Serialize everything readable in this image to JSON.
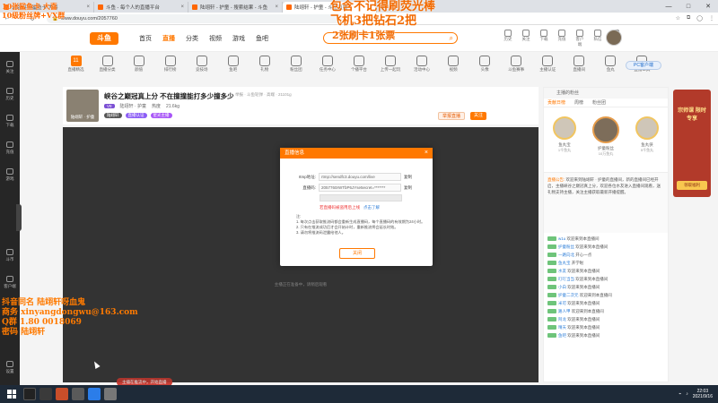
{
  "browser": {
    "tabs": [
      {
        "label": "10张斗鱼鲨鱼卡  大喜",
        "active": false
      },
      {
        "label": "斗鱼 - 每个人的直播平台",
        "active": false
      },
      {
        "label": "陆翊轩 - 护童 - 搜索结果 - 斗鱼",
        "active": false
      },
      {
        "label": "陆翊轩 - 护童 - 斗鱼直播",
        "active": true
      }
    ],
    "url": "www.douyu.com/2057760"
  },
  "site": {
    "logo_text": "斗鱼",
    "nav": [
      "首页",
      "直播",
      "分类",
      "视频",
      "游戏",
      "鱼吧"
    ],
    "header_icons": [
      "历史",
      "关注",
      "下载",
      "充值",
      "客户端",
      "私信",
      "通知"
    ]
  },
  "categories": [
    {
      "label": "直播精选",
      "top": "11",
      "sub": "开播数"
    },
    {
      "label": "直播分类"
    },
    {
      "label": "颜值"
    },
    {
      "label": "排行榜"
    },
    {
      "label": "竞技场"
    },
    {
      "label": "鱼吧"
    },
    {
      "label": "礼物"
    },
    {
      "label": "粉丝团"
    },
    {
      "label": "任务中心"
    },
    {
      "label": "个播平台"
    },
    {
      "label": "上传一起玩"
    },
    {
      "label": "活动中心"
    },
    {
      "label": "视频"
    },
    {
      "label": "头像"
    },
    {
      "label": "斗鱼赛事"
    },
    {
      "label": "主播认证"
    },
    {
      "label": "直播间"
    },
    {
      "label": "鱼丸"
    },
    {
      "label": "直播工具"
    }
  ],
  "pc_client_button": "PC客户端",
  "sidebar": [
    "关注",
    "历史",
    "下载",
    "充值",
    "游戏",
    "斗币",
    "客户端",
    "设置"
  ],
  "room": {
    "title": "峡谷之巅冠真上分 不在撞撞能打多少撞多少",
    "subtitle": "举报  · 斗鱼轮弹 · 高端 · 21101g",
    "streamer": "陆翊轩 · 护童",
    "thumb_label": "陆翊轩 · 护童",
    "level_tag": "V8",
    "hot": "热度",
    "fans": "21.6kg",
    "badges": [
      "陆翊轩",
      "直播认证",
      "星光主播"
    ],
    "report_label": "举报直播",
    "follow_label": "关注"
  },
  "player": {
    "message": "主播正在准备中，请稍后观看",
    "bottom_banner": "主播在推流中，开始直播"
  },
  "modal": {
    "title": "直播信息",
    "rtmp_label": "rtmp地址:",
    "rtmp_value": "rtmp://sendfc3.douyu.com/live",
    "rtmp_copy": "复制",
    "code_label": "直播码:",
    "code_value": "2057760rWTbP6JYse5ecret=*******",
    "code_copy": "复制",
    "warn": "若直播码被盗用后上线",
    "warn_link": "点击了解",
    "notes_title": "注:",
    "notes": [
      "1. 每次点击获取推流码都会重新生成直播码，每个直播码的有效期为24小时。",
      "2. 只有在推流成功后才会开始计时，重新推流将会延长时效。",
      "3. 请勿将推流码泄露给他人。"
    ],
    "ok_label": "关闭"
  },
  "right_panel": {
    "header": "主播的粉丝",
    "tabs": [
      "贡献日榜",
      "周榜",
      "粉丝团"
    ],
    "ranks": [
      {
        "name": "鱼丸宝",
        "sub": "1千鱼丸"
      },
      {
        "name": "护童粉丝",
        "sub": "10万鱼丸"
      },
      {
        "name": "鱼丸侠",
        "sub": "5千鱼丸"
      }
    ],
    "notice_label": "直播公告:",
    "notice": "欢迎来到陆翊轩 · 护童的直播间，新的直播间已经开启，主播峡谷之巅冠真上分，欢迎各位水友进入直播间观看，送礼物支持主播，关注主播获取最新开播提醒。",
    "chat": [
      {
        "user": "w1u",
        "text": "欢迎来到本直播间"
      },
      {
        "user": "护童粉丝",
        "text": "欢迎来到本直播间"
      },
      {
        "user": "一路向北",
        "text": "开心一点"
      },
      {
        "user": "鱼丸宝",
        "text": "开学啦"
      },
      {
        "user": "水友",
        "text": "欢迎来到本直播间"
      },
      {
        "user": "叮叮当当",
        "text": "欢迎来到本直播间"
      },
      {
        "user": "小白",
        "text": "欢迎来到本直播间"
      },
      {
        "user": "护童二次元",
        "text": "欢迎来到本直播间"
      },
      {
        "user": "米可",
        "text": "欢迎来到本直播间"
      },
      {
        "user": "路人甲",
        "text": "欢迎来到本直播间"
      },
      {
        "user": "阿龙",
        "text": "欢迎来到本直播间"
      },
      {
        "user": "晴天",
        "text": "欢迎来到本直播间"
      },
      {
        "user": "鱼吧",
        "text": "欢迎来到本直播间"
      }
    ]
  },
  "promo": {
    "title": "宗师课 限时专享",
    "button": "领取福利"
  },
  "overlays": {
    "top_left_1": "10张鲨鱼卡  大喜",
    "top_left_2": "10级粉丝牌+VX群",
    "center_1": "包含不记得刷荧光棒",
    "center_2": "飞机3把钻石2把",
    "center_3": "2张刷卡1张票",
    "bottom_left_1": "抖音同名  陆翊轩呀血鬼",
    "bottom_left_2": "商务 xinyangdongwu@163.com",
    "bottom_left_3": "Q群 1.80 0018069",
    "bottom_left_4": "密码 陆翊轩"
  },
  "taskbar": {
    "time": "22:03",
    "date": "2021/9/16"
  },
  "colors": {
    "brand": "#ff7800",
    "dark": "#262626",
    "player": "#3c3c3c"
  }
}
